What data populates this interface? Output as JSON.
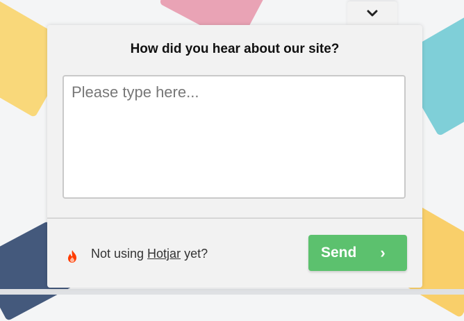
{
  "survey": {
    "question": "How did you hear about our site?",
    "answer_placeholder": "Please type here...",
    "answer_value": "",
    "footer_prefix": "Not using ",
    "footer_link": "Hotjar",
    "footer_suffix": " yet?",
    "send_label": "Send",
    "send_chevron": "›"
  },
  "icons": {
    "collapse": "chevron-down-icon",
    "brand": "hotjar-flame-icon"
  },
  "colors": {
    "send_button": "#5cc16e",
    "flame": "#ff3c00",
    "panel": "#f2f2f2"
  }
}
